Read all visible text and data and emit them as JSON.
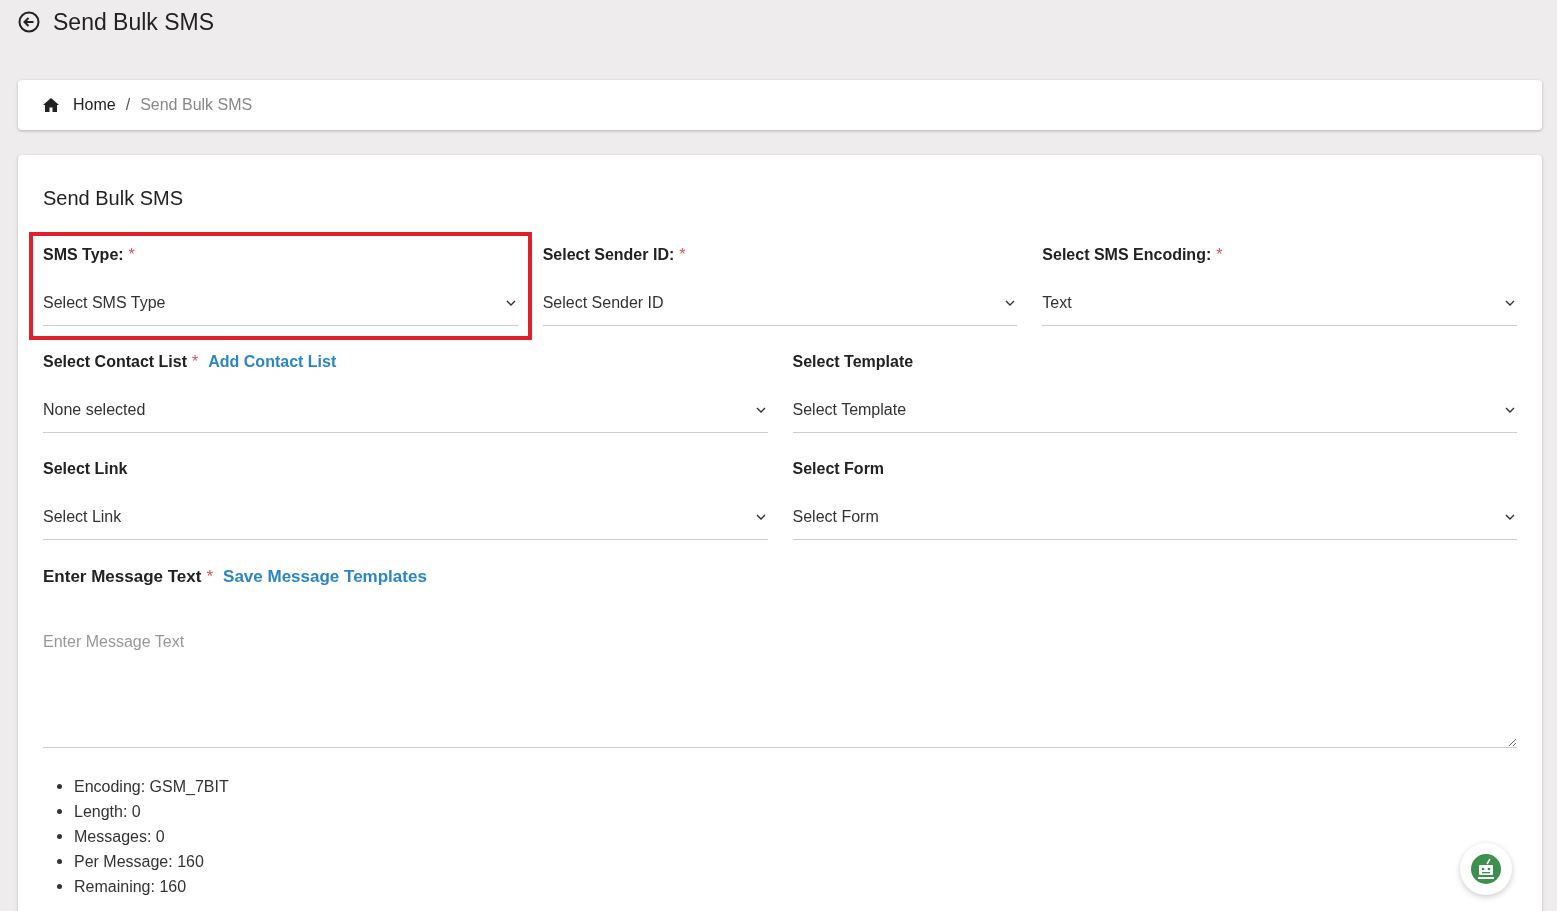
{
  "header": {
    "title": "Send Bulk SMS"
  },
  "breadcrumb": [
    {
      "label": "Home",
      "kind": "home"
    },
    {
      "label": "Send Bulk SMS",
      "kind": "current",
      "separator": "/"
    }
  ],
  "form": {
    "title": "Send Bulk SMS",
    "rows": [
      [
        {
          "label": "SMS Type:",
          "required_mark": "*",
          "value": "Select SMS Type",
          "highlighted": true
        },
        {
          "label": "Select Sender ID:",
          "required_mark": "*",
          "value": "Select Sender ID"
        },
        {
          "label": "Select SMS Encoding:",
          "required_mark": "*",
          "value": "Text"
        }
      ],
      [
        {
          "label": "Select Contact List",
          "required_mark": "*",
          "link": "Add Contact List",
          "value": "None selected"
        },
        {
          "label": "Select Template",
          "value": "Select Template"
        }
      ],
      [
        {
          "label": "Select Link",
          "value": "Select Link"
        },
        {
          "label": "Select Form",
          "value": "Select Form"
        }
      ]
    ],
    "message": {
      "label": "Enter Message Text",
      "required_mark": "*",
      "link": "Save Message Templates",
      "placeholder": "Enter Message Text"
    },
    "stats": [
      "Encoding: GSM_7BIT",
      "Length: 0",
      "Messages: 0",
      "Per Message: 160",
      "Remaining: 160"
    ]
  }
}
